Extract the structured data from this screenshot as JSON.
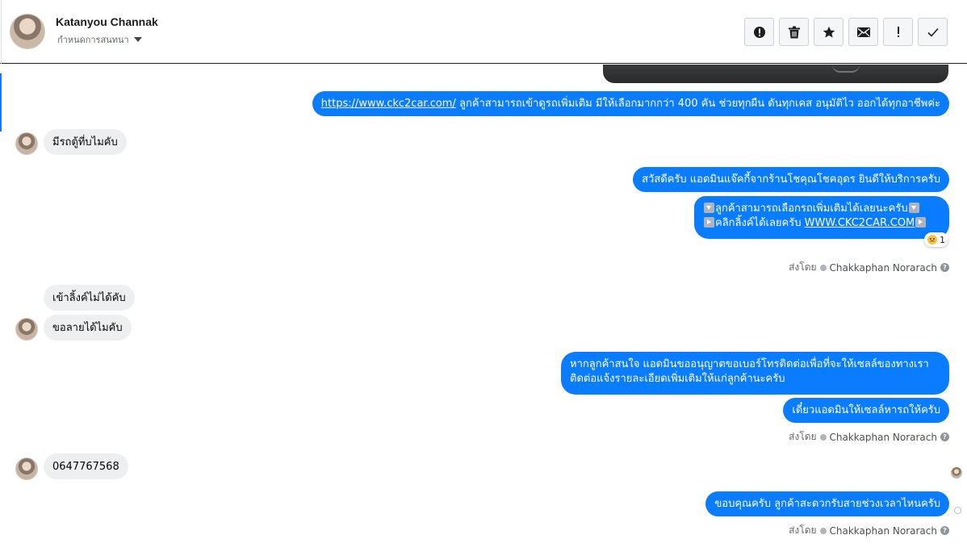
{
  "header": {
    "name": "Katanyou Channak",
    "subtitle": "กำหนดการสนทนา",
    "actions": [
      {
        "icon": "alert-circle-icon",
        "label": "Mark as spam"
      },
      {
        "icon": "trash-icon",
        "label": "Delete"
      },
      {
        "icon": "star-icon",
        "label": "Star"
      },
      {
        "icon": "envelope-icon",
        "label": "Mark unread"
      },
      {
        "icon": "exclamation-icon",
        "label": "Follow up"
      },
      {
        "icon": "check-icon",
        "label": "Mark done"
      }
    ]
  },
  "messages": {
    "m1": {
      "link": "https://www.ckc2car.com/",
      "text": " ลูกค้าสามารถเข้าดูรถเพิ่มเติม มีให้เลือกมากกว่า 400 คัน ช่วยทุกผืน ดันทุกเคส อนุมัติไว ออกได้ทุกอาชีพค่ะ"
    },
    "m2": "มีรถตู้ที่บไมคับ",
    "m3": "สวัสดีครับ แอดมินแจ๊คกี้จากร้านโชคุณโชคอุดร ยินดีให้บริการครับ",
    "m4": {
      "line1": "ลูกค้าสามารถเลือกรถเพิ่มเติมได้เลยนะครับ",
      "line2_text": "คลิกลิ้งค์ได้เลยครับ ",
      "line2_link": "WWW.CKC2CAR.COM"
    },
    "m4_reaction_count": "1",
    "m5": "เข้าลิ้งค์ไม่ได้คับ",
    "m6": "ขอลายได้ไมคับ",
    "m7": {
      "line1": "หากลูกค้าสนใจ แอดมินขออนุญาตขอเบอร์โทรติดต่อเพื่อที่จะให้เซลล์ของทางเรา",
      "line2": "ติดต่อแจ้งรายละเอียดเพิ่มเติมให้แก่ลูกค้านะครับ"
    },
    "m8": "เดี๋ยวแอดมินให้เซลล์หารถให้ครับ",
    "m9": "0647767568",
    "m10": "ขอบคุณครับ ลูกค้าสะดวกรับสายช่วงเวลาไหนครับ"
  },
  "sent_by": {
    "prefix": "ส่งโดย",
    "agent": "Chakkaphan Norarach",
    "help": "?"
  },
  "colors": {
    "outgoing_bubble": "#0a7cff",
    "incoming_bubble": "#eeeff1",
    "active_indicator": "#1877f2"
  }
}
